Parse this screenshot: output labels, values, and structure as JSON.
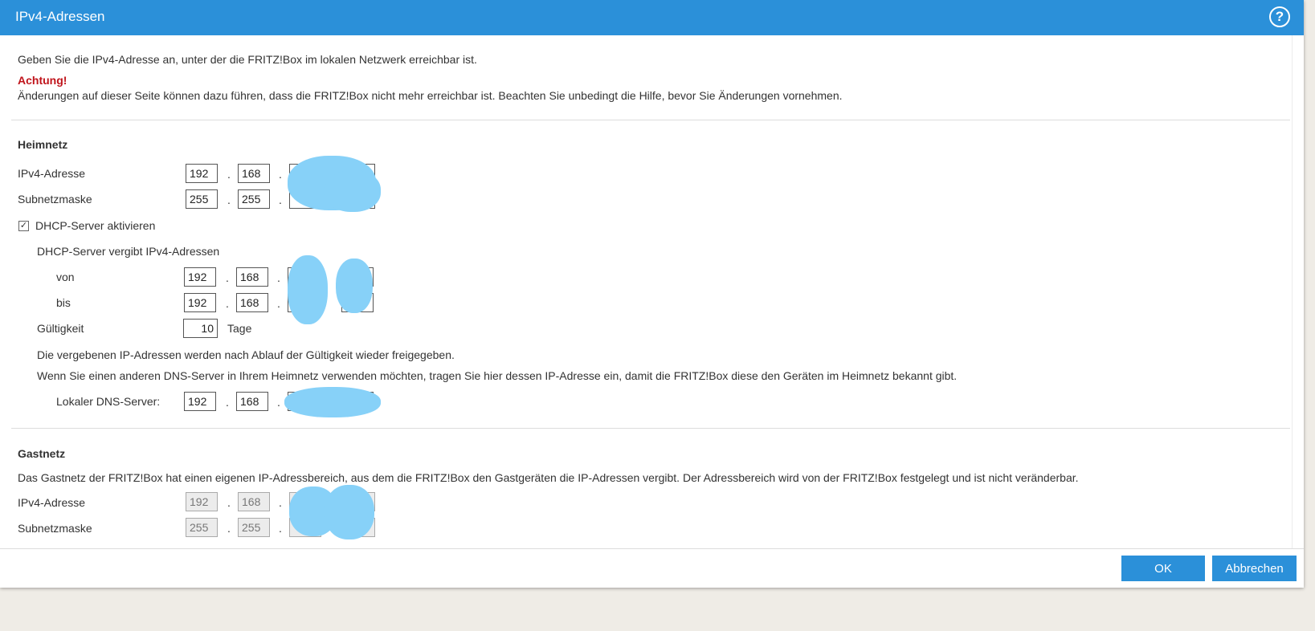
{
  "dialog": {
    "title": "IPv4-Adressen"
  },
  "intro": {
    "text": "Geben Sie die IPv4-Adresse an, unter der die FRITZ!Box im lokalen Netzwerk erreichbar ist.",
    "warning_title": "Achtung!",
    "warning_text": "Änderungen auf dieser Seite können dazu führen, dass die FRITZ!Box nicht mehr erreichbar ist. Beachten Sie unbedingt die Hilfe, bevor Sie Änderungen vornehmen."
  },
  "heimnetz": {
    "heading": "Heimnetz",
    "ipv4_label": "IPv4-Adresse",
    "ipv4": [
      "192",
      "168"
    ],
    "subnet_label": "Subnetzmaske",
    "subnet": [
      "255",
      "255"
    ],
    "dhcp_checkbox_label": "DHCP-Server aktivieren",
    "dhcp_range_label": "DHCP-Server vergibt IPv4-Adressen",
    "from_label": "von",
    "from": [
      "192",
      "168"
    ],
    "to_label": "bis",
    "to": [
      "192",
      "168"
    ],
    "validity_label": "Gültigkeit",
    "validity_value": "10",
    "validity_unit": "Tage",
    "validity_note": "Die vergebenen IP-Adressen werden nach Ablauf der Gültigkeit wieder freigegeben.",
    "dns_note": "Wenn Sie einen anderen DNS-Server in Ihrem Heimnetz verwenden möchten, tragen Sie hier dessen IP-Adresse ein, damit die FRITZ!Box diese den Geräten im Heimnetz bekannt gibt.",
    "dns_label": "Lokaler DNS-Server:",
    "dns": [
      "192",
      "168"
    ]
  },
  "gastnetz": {
    "heading": "Gastnetz",
    "note": "Das Gastnetz der FRITZ!Box hat einen eigenen IP-Adressbereich, aus dem die FRITZ!Box den Gastgeräten die IP-Adressen vergibt. Der Adressbereich wird von der FRITZ!Box festgelegt und ist nicht veränderbar.",
    "ipv4_label": "IPv4-Adresse",
    "ipv4": [
      "192",
      "168"
    ],
    "subnet_label": "Subnetzmaske",
    "subnet": [
      "255",
      "255"
    ]
  },
  "separator": ".",
  "buttons": {
    "ok": "OK",
    "cancel": "Abbrechen"
  },
  "colors": {
    "accent": "#2b90d9",
    "warning": "#c0141b",
    "redaction": "#87d1f8"
  },
  "icons": {
    "help": "?",
    "check": "✓"
  }
}
